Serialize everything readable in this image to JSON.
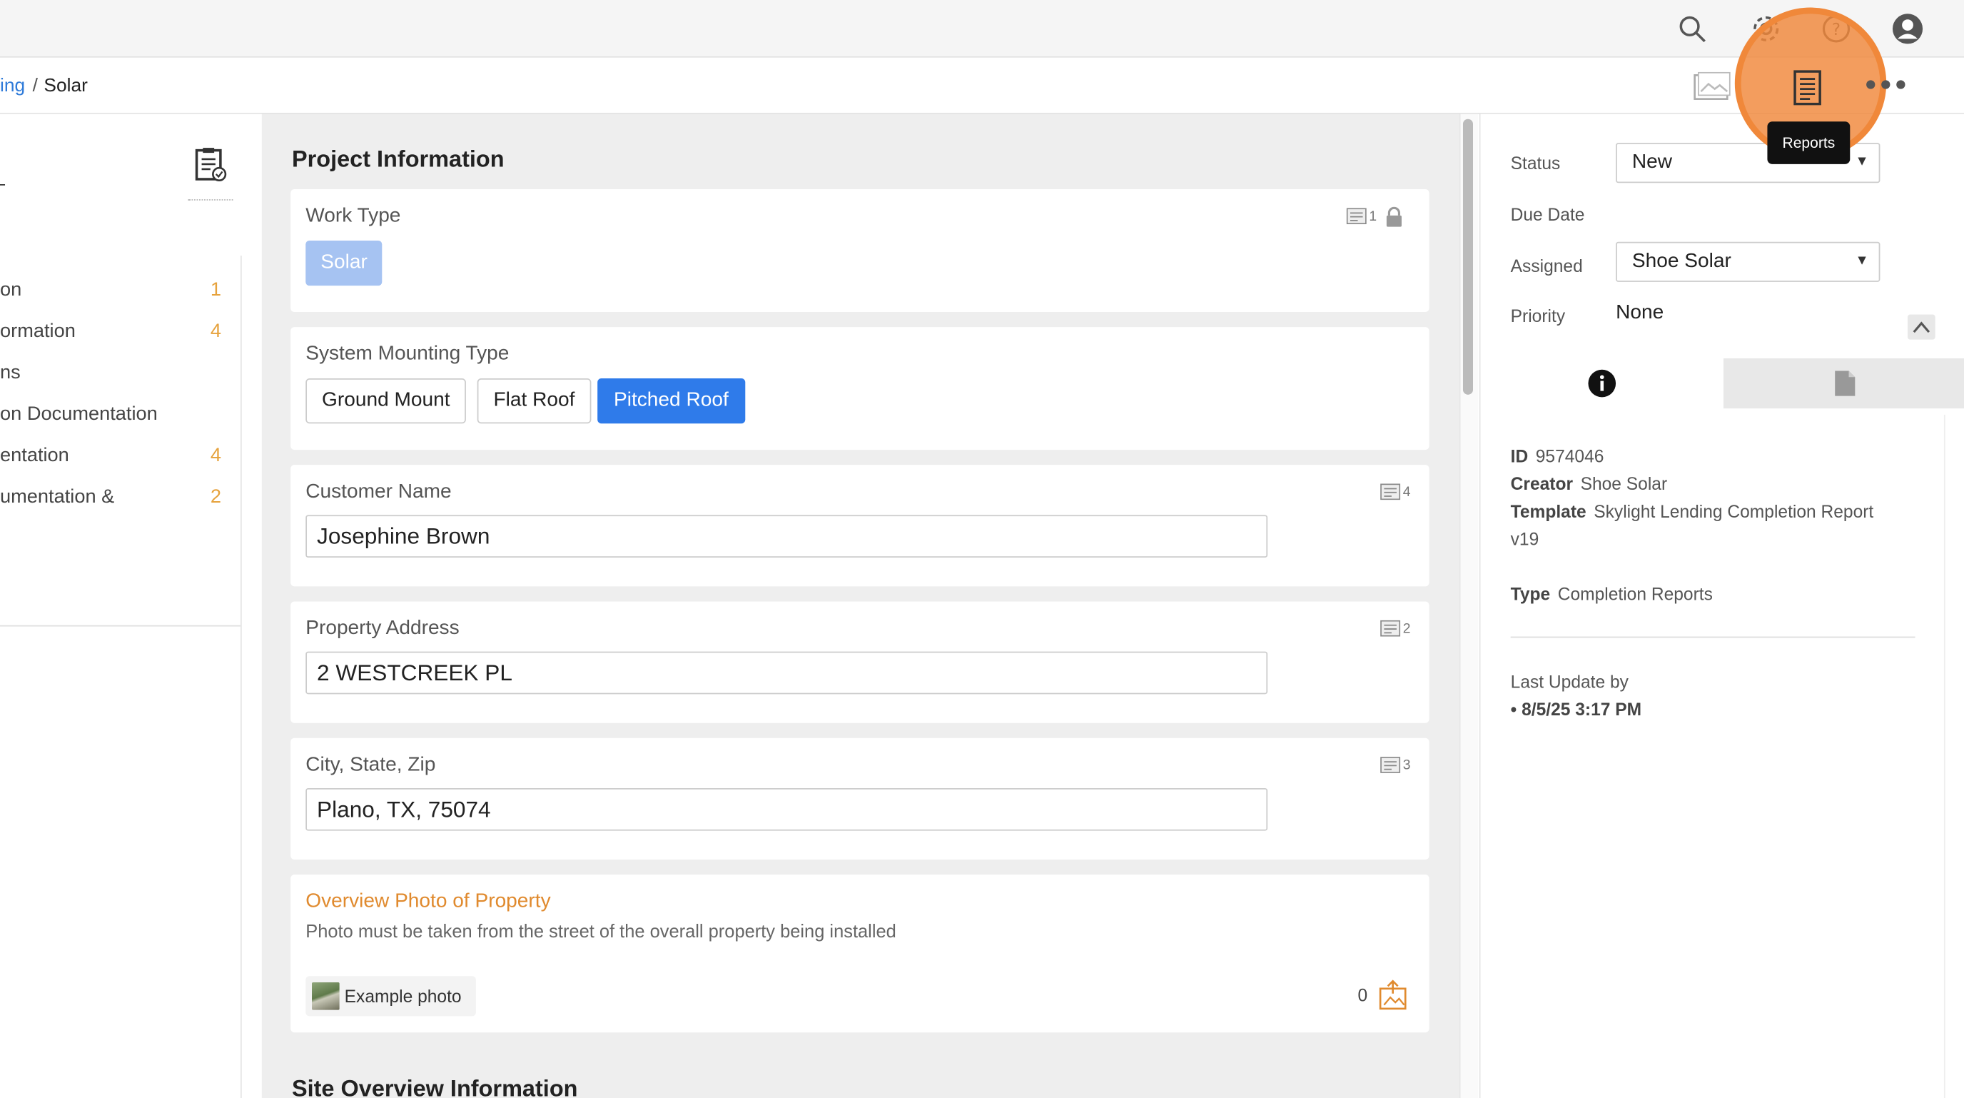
{
  "breadcrumb": {
    "parent": "ing",
    "separator": "/",
    "current": "Solar"
  },
  "top_icons": [
    "search-icon",
    "gear-icon",
    "help-icon",
    "user-avatar-icon"
  ],
  "toolbar": {
    "reports_tooltip": "Reports"
  },
  "sidebar": {
    "items": [
      {
        "label": "on",
        "count": "1"
      },
      {
        "label": "ormation",
        "count": "4"
      },
      {
        "label": "ns",
        "count": ""
      },
      {
        "label": "on Documentation",
        "count": ""
      },
      {
        "label": "entation",
        "count": "4"
      },
      {
        "label": "umentation &",
        "count": "2"
      }
    ]
  },
  "main": {
    "section_title": "Project Information",
    "next_section_title": "Site Overview Information",
    "work_type": {
      "label": "Work Type",
      "badge_count": "1",
      "value": "Solar"
    },
    "mounting": {
      "label": "System Mounting Type",
      "options": [
        "Ground Mount",
        "Flat Roof",
        "Pitched Roof"
      ],
      "selected": "Pitched Roof"
    },
    "customer_name": {
      "label": "Customer Name",
      "badge_count": "4",
      "value": "Josephine Brown"
    },
    "property_address": {
      "label": "Property Address",
      "badge_count": "2",
      "value": "2 WESTCREEK PL"
    },
    "city_state_zip": {
      "label": "City, State, Zip",
      "badge_count": "3",
      "value": "Plano, TX, 75074"
    },
    "overview_photo": {
      "title": "Overview Photo of Property",
      "description": "Photo must be taken from the street of the overall property being installed",
      "example_label": "Example photo",
      "photo_count": "0"
    }
  },
  "right_panel": {
    "status_label": "Status",
    "status_value": "New",
    "due_date_label": "Due Date",
    "assigned_label": "Assigned",
    "assigned_value": "Shoe Solar",
    "priority_label": "Priority",
    "priority_value": "None",
    "id_label": "ID",
    "id_value": "9574046",
    "creator_label": "Creator",
    "creator_value": "Shoe Solar",
    "template_label": "Template",
    "template_value": "Skylight Lending Completion Report",
    "template_version": "v19",
    "type_label": "Type",
    "type_value": "Completion Reports",
    "last_update_label": "Last Update by",
    "last_update_value": "• 8/5/25 3:17 PM"
  },
  "colors": {
    "accent_blue": "#2f7bea",
    "chip_light_blue": "#a6c3f2",
    "highlight_orange": "#f0883a",
    "count_orange": "#e6a23c"
  }
}
